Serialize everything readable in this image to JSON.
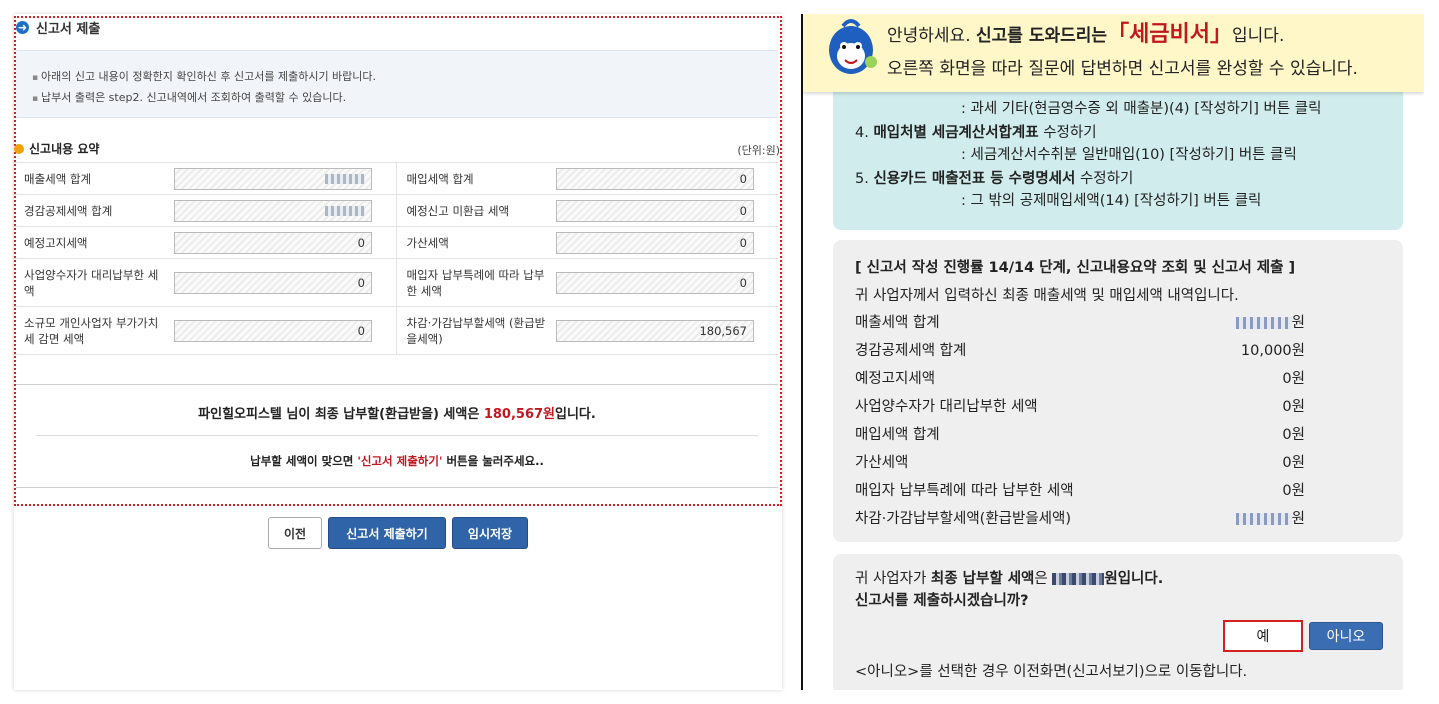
{
  "left": {
    "section_title": "신고서 제출",
    "notices": [
      "아래의 신고 내용이 정확한지 확인하신 후 신고서를 제출하시기 바랍니다.",
      "납부서 출력은 step2. 신고내역에서 조회하여 출력할 수 있습니다."
    ],
    "summary_title": "신고내용 요약",
    "unit": "(단위:원)",
    "rows": [
      {
        "l_label": "매출세액 합계",
        "l_value": "",
        "r_label": "매입세액 합계",
        "r_value": "0"
      },
      {
        "l_label": "경감공제세액 합계",
        "l_value": "",
        "r_label": "예정신고 미환급 세액",
        "r_value": "0"
      },
      {
        "l_label": "예정고지세액",
        "l_value": "0",
        "r_label": "가산세액",
        "r_value": "0"
      },
      {
        "l_label": "사업양수자가 대리납부한 세액",
        "l_value": "0",
        "r_label": "매입자 납부특례에 따라 납부한 세액",
        "r_value": "0"
      },
      {
        "l_label": "소규모 개인사업자 부가가치세 감면 세액",
        "l_value": "0",
        "r_label": "차감·가감납부할세액 (환급받을세액)",
        "r_value": "180,567"
      }
    ],
    "result_prefix": "파인힐오피스텔 님이 최종 납부할(환급받을) 세액은 ",
    "result_amount": "180,567원",
    "result_suffix": "입니다.",
    "instruction_prefix": "납부할 세액이 맞으면 ",
    "instruction_highlight": "'신고서 제출하기'",
    "instruction_suffix": " 버튼을 눌러주세요..",
    "buttons": {
      "prev": "이전",
      "submit": "신고서 제출하기",
      "save": "임시저장"
    }
  },
  "right": {
    "banner": {
      "greeting": "안녕하세요. ",
      "bold": "신고를 도와드리는",
      "brand": "「세금비서」",
      "tail": "입니다.",
      "line2": "오른쪽 화면을 따라 질문에 답변하면 신고서를 완성할 수 있습니다."
    },
    "guide": [
      {
        "step": "",
        "sub": ": 과세 기타(현금영수증 외 매출분)(4) [작성하기] 버튼 클릭"
      },
      {
        "num": "4. ",
        "bold": "매입처별 세금계산서합계표",
        "rest": " 수정하기",
        "sub": ": 세금계산서수취분 일반매입(10) [작성하기] 버튼 클릭"
      },
      {
        "num": "5. ",
        "bold": "신용카드 매출전표 등 수령명세서",
        "rest": " 수정하기",
        "sub": ": 그 밖의 공제매입세액(14) [작성하기] 버튼 클릭"
      }
    ],
    "progress_header": "[ 신고서 작성 진행률 14/14 단계, 신고내용요약 조회 및 신고서 제출 ]",
    "progress_desc": "귀 사업자께서 입력하신 최종 매출세액 및 매입세액 내역입니다.",
    "summary": [
      {
        "label": "매출세액 합계",
        "value": "원"
      },
      {
        "label": "경감공제세액 합계",
        "value": "10,000원"
      },
      {
        "label": "예정고지세액",
        "value": "0원"
      },
      {
        "label": "사업양수자가 대리납부한 세액",
        "value": "0원"
      },
      {
        "label": "매입세액 합계",
        "value": "0원"
      },
      {
        "label": "가산세액",
        "value": "0원"
      },
      {
        "label": "매입자 납부특례에 따라 납부한 세액",
        "value": "0원"
      },
      {
        "label": "차감·가감납부할세액(환급받을세액)",
        "value": "원"
      }
    ],
    "confirm_prefix": "귀 사업자가 ",
    "confirm_bold": "최종 납부할 세액",
    "confirm_mid": "은 ",
    "confirm_tail": "원입니다.",
    "confirm_question": "신고서를 제출하시겠습니까?",
    "yes": "예",
    "no": "아니오",
    "footnote": "<아니오>를 선택한 경우 이전화면(신고서보기)으로 이동합니다."
  },
  "colors": {
    "accent_blue": "#2f65a8",
    "alert_red": "#c0181f",
    "banner_bg": "#fff7c8",
    "guide_bg": "#d1ecec"
  }
}
